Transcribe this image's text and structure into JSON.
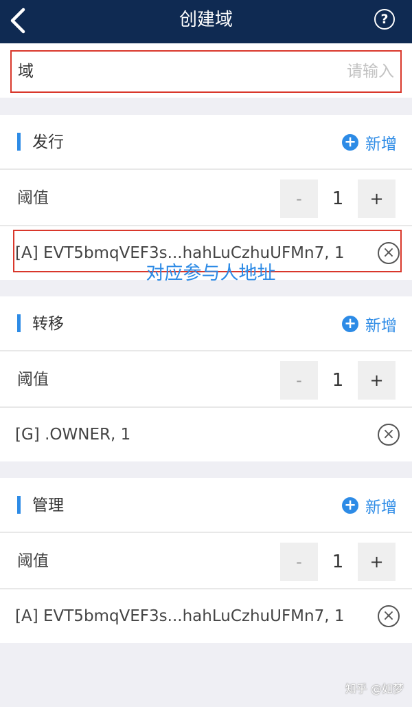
{
  "navbar": {
    "title": "创建域",
    "help_symbol": "?"
  },
  "domain": {
    "label": "域",
    "placeholder": "请输入"
  },
  "sections": [
    {
      "title": "发行",
      "add_label": "新增",
      "threshold_label": "阈值",
      "threshold_value": "1",
      "minus": "-",
      "plus": "+",
      "entry": "[A] EVT5bmqVEF3s...hahLuCzhuUFMn7, 1"
    },
    {
      "title": "转移",
      "add_label": "新增",
      "threshold_label": "阈值",
      "threshold_value": "1",
      "minus": "-",
      "plus": "+",
      "entry": "[G] .OWNER, 1"
    },
    {
      "title": "管理",
      "add_label": "新增",
      "threshold_label": "阈值",
      "threshold_value": "1",
      "minus": "-",
      "plus": "+",
      "entry": "[A] EVT5bmqVEF3s...hahLuCzhuUFMn7, 1"
    }
  ],
  "annotation": "对应参与人地址",
  "watermark": "知乎 @如梦",
  "colors": {
    "navbar": "#0f2a52",
    "accent": "#2d8be6",
    "highlight": "#d9372b",
    "background": "#efeff4"
  },
  "icons": {
    "back": "chevron-left-icon",
    "help": "help-circle-icon",
    "add": "plus-circle-icon",
    "remove": "close-circle-icon"
  }
}
